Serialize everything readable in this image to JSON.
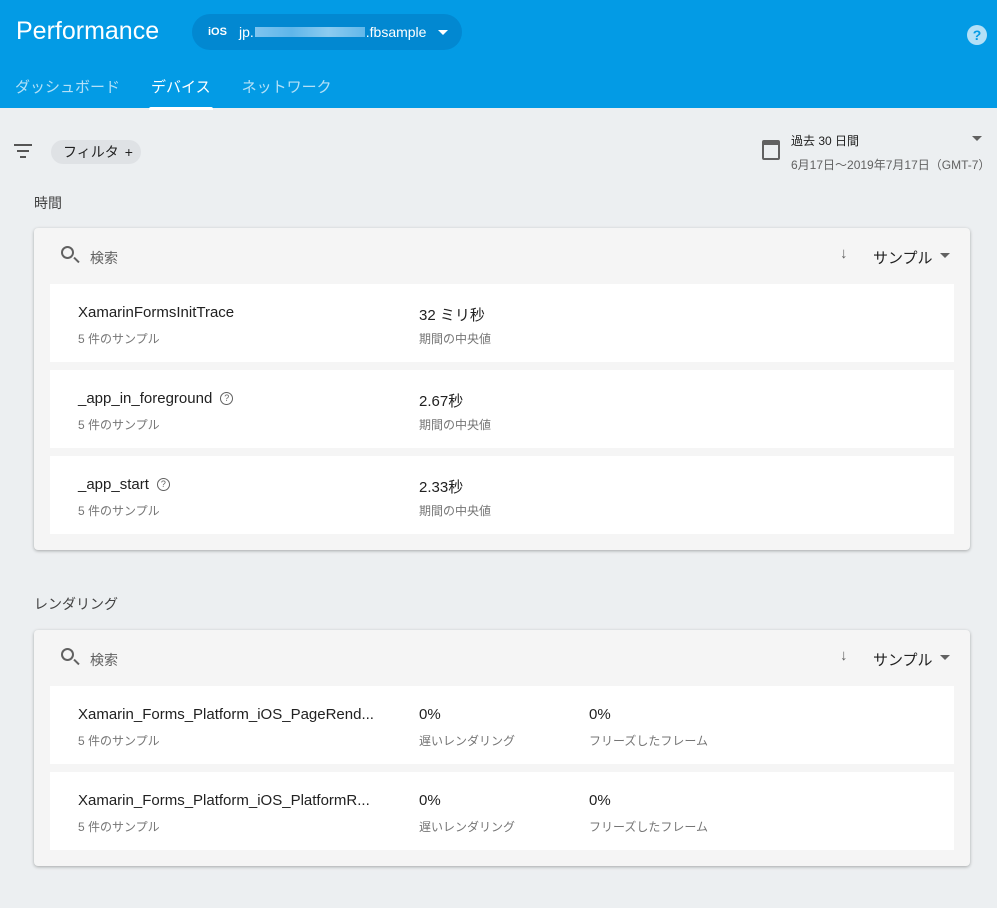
{
  "header": {
    "title": "Performance",
    "platform": "iOS",
    "app_prefix": "jp.",
    "app_suffix": ".fbsample",
    "help": "?"
  },
  "tabs": [
    {
      "label": "ダッシュボード"
    },
    {
      "label": "デバイス",
      "active": true
    },
    {
      "label": "ネットワーク"
    }
  ],
  "filter": {
    "label": "フィルタ",
    "add": "+"
  },
  "date": {
    "range": "過去 30 日間",
    "detail": "6月17日～2019年7月17日（GMT-7）"
  },
  "sections": [
    {
      "title": "時間",
      "search_placeholder": "検索",
      "sort_arrow": "↓",
      "sort_label": "サンプル",
      "rows": [
        {
          "name": "XamarinFormsInitTrace",
          "help": false,
          "samples": "5 件のサンプル",
          "value": "32 ミリ秒",
          "value_label": "期間の中央値"
        },
        {
          "name": "_app_in_foreground",
          "help": true,
          "samples": "5 件のサンプル",
          "value": "2.67秒",
          "value_label": "期間の中央値"
        },
        {
          "name": "_app_start",
          "help": true,
          "samples": "5 件のサンプル",
          "value": "2.33秒",
          "value_label": "期間の中央値"
        }
      ]
    },
    {
      "title": "レンダリング",
      "search_placeholder": "検索",
      "sort_arrow": "↓",
      "sort_label": "サンプル",
      "rows": [
        {
          "name": "Xamarin_Forms_Platform_iOS_PageRend...",
          "samples": "5 件のサンプル",
          "value": "0%",
          "value_label": "遅いレンダリング",
          "value2": "0%",
          "value2_label": "フリーズしたフレーム"
        },
        {
          "name": "Xamarin_Forms_Platform_iOS_PlatformR...",
          "samples": "5 件のサンプル",
          "value": "0%",
          "value_label": "遅いレンダリング",
          "value2": "0%",
          "value2_label": "フリーズしたフレーム"
        }
      ]
    }
  ]
}
